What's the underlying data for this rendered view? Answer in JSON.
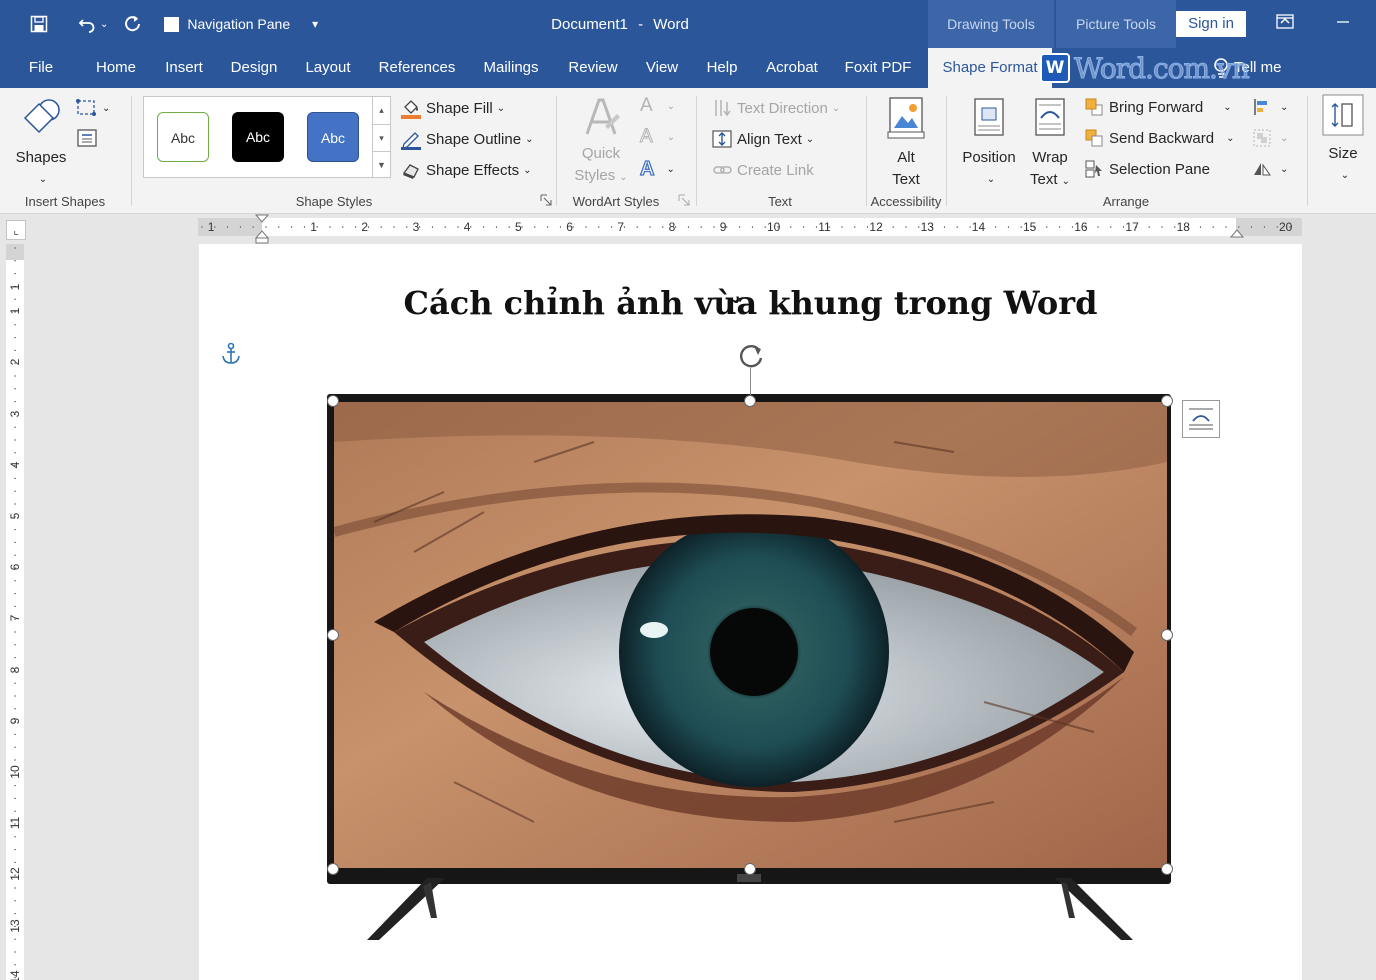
{
  "app": {
    "document_title": "Document1",
    "title_separator": "-",
    "app_name": "Word",
    "navigation_pane_label": "Navigation Pane",
    "context_tabs": [
      "Drawing Tools",
      "Picture Tools"
    ],
    "sign_in_label": "Sign in"
  },
  "tabs": [
    "File",
    "Home",
    "Insert",
    "Design",
    "Layout",
    "References",
    "Mailings",
    "Review",
    "View",
    "Help",
    "Acrobat",
    "Foxit PDF",
    "Shape Format"
  ],
  "active_tab": "Shape Format",
  "tell_me_label": "Tell me",
  "watermark": {
    "logo_letter": "W",
    "text": "Word.com.vn"
  },
  "ribbon": {
    "insert_shapes": {
      "shapes_label": "Shapes",
      "group_label": "Insert Shapes"
    },
    "shape_styles": {
      "swatches": [
        "Abc",
        "Abc",
        "Abc"
      ],
      "fill_label": "Shape Fill",
      "outline_label": "Shape Outline",
      "effects_label": "Shape Effects",
      "group_label": "Shape Styles"
    },
    "wordart_styles": {
      "quick_styles_line1": "Quick",
      "quick_styles_line2": "Styles",
      "group_label": "WordArt Styles"
    },
    "text": {
      "direction_label": "Text Direction",
      "align_label": "Align Text",
      "link_label": "Create Link",
      "group_label": "Text"
    },
    "accessibility": {
      "alt_text_line1": "Alt",
      "alt_text_line2": "Text",
      "group_label": "Accessibility"
    },
    "arrange": {
      "position_label": "Position",
      "wrap_line1": "Wrap",
      "wrap_line2": "Text",
      "bring_forward_label": "Bring Forward",
      "send_backward_label": "Send Backward",
      "selection_pane_label": "Selection Pane",
      "group_label": "Arrange"
    },
    "size": {
      "size_label": "Size"
    }
  },
  "ruler": {
    "horizontal": [
      "1",
      "1",
      "2",
      "3",
      "4",
      "5",
      "6",
      "7",
      "8",
      "9",
      "10",
      "11",
      "12",
      "13",
      "14",
      "15",
      "16",
      "17",
      "18",
      "20"
    ],
    "vertical": [
      "1",
      "1",
      "2",
      "3",
      "4",
      "5",
      "6",
      "7",
      "8",
      "9",
      "10",
      "11",
      "12",
      "13",
      "14"
    ]
  },
  "document": {
    "heading": "Cách chỉnh ảnh vừa khung trong Word"
  },
  "colors": {
    "brand": "#2b579a",
    "ribbon_bg": "#f3f3f3",
    "swatch_blue": "#4472c4",
    "fill_orange": "#ed7d31"
  }
}
